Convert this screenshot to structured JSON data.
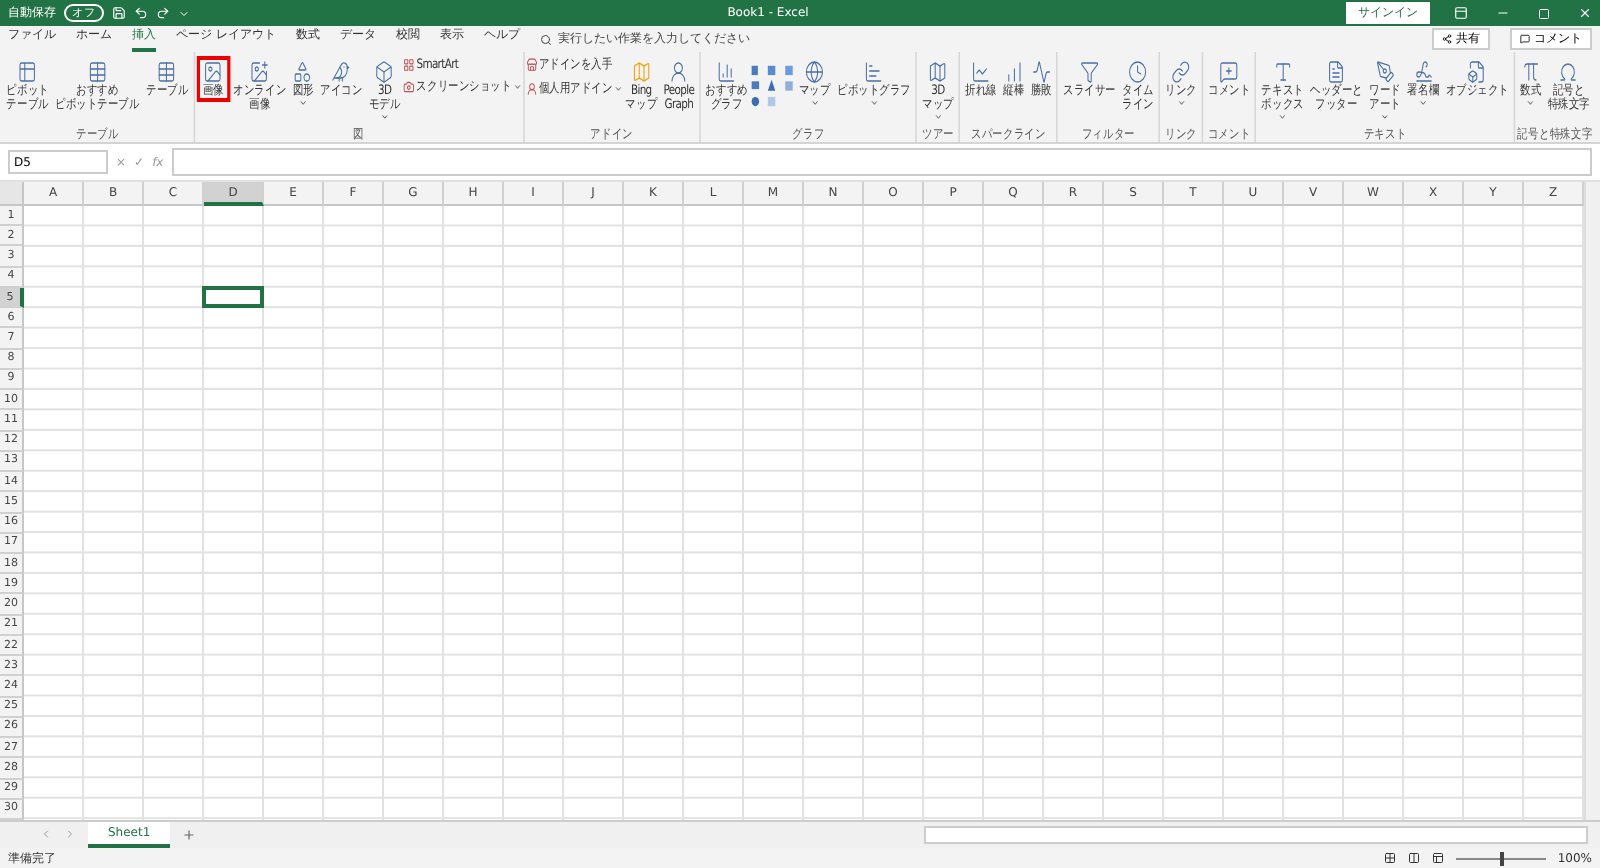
{
  "title_bar": {
    "autosave_label": "自動保存",
    "autosave_toggle": "オフ",
    "autosave_on": false,
    "title": "Book1  -  Excel",
    "sign_in": "サインイン"
  },
  "menu_tabs": [
    {
      "label": "ファイル",
      "selected": false
    },
    {
      "label": "ホーム",
      "selected": false
    },
    {
      "label": "挿入",
      "selected": true
    },
    {
      "label": "ページ レイアウト",
      "selected": false
    },
    {
      "label": "数式",
      "selected": false
    },
    {
      "label": "データ",
      "selected": false
    },
    {
      "label": "校閲",
      "selected": false
    },
    {
      "label": "表示",
      "selected": false
    },
    {
      "label": "ヘルプ",
      "selected": false
    }
  ],
  "search": {
    "placeholder": "実行したい作業を入力してください"
  },
  "share_button": "共有",
  "comment_button": "コメント",
  "ribbon_groups": [
    {
      "name": "テーブル",
      "buttons": [
        {
          "lines": [
            "ピボット",
            "テーブル"
          ],
          "dropdown": false,
          "highlighted": false
        },
        {
          "lines": [
            "おすすめ",
            "ピボットテーブル"
          ],
          "dropdown": false,
          "highlighted": false
        },
        {
          "lines": [
            "テーブル"
          ],
          "dropdown": false,
          "highlighted": false
        }
      ]
    },
    {
      "name": "図",
      "buttons": [
        {
          "lines": [
            "画像"
          ],
          "dropdown": false,
          "highlighted": true
        },
        {
          "lines": [
            "オンライン",
            "画像"
          ],
          "dropdown": false,
          "highlighted": false
        },
        {
          "lines": [
            "図形"
          ],
          "dropdown": true,
          "highlighted": false
        },
        {
          "lines": [
            "アイコン"
          ],
          "dropdown": false,
          "highlighted": false
        },
        {
          "lines": [
            "3D",
            "モデル"
          ],
          "dropdown": true,
          "highlighted": false
        }
      ],
      "small_buttons": [
        {
          "label": "SmartArt",
          "dropdown": false
        },
        {
          "label": "スクリーンショット",
          "dropdown": true
        }
      ]
    },
    {
      "name": "アドイン",
      "small_buttons": [
        {
          "label": "アドインを入手",
          "dropdown": false
        },
        {
          "label": "個人用アドイン",
          "dropdown": true
        }
      ],
      "after": [
        {
          "lines": [
            "Bing",
            "マップ"
          ],
          "dropdown": false,
          "highlighted": false
        },
        {
          "lines": [
            "People",
            "Graph"
          ],
          "dropdown": false,
          "highlighted": false
        }
      ]
    },
    {
      "name": "グラフ",
      "buttons": [
        {
          "lines": [
            "おすすめ",
            "グラフ"
          ],
          "dropdown": false,
          "highlighted": false
        }
      ],
      "after": [
        {
          "lines": [
            "マップ"
          ],
          "dropdown": true,
          "highlighted": false
        },
        {
          "lines": [
            "ピボットグラフ"
          ],
          "dropdown": true,
          "highlighted": false
        }
      ]
    },
    {
      "name": "ツアー",
      "buttons": [
        {
          "lines": [
            "3D",
            "マップ"
          ],
          "dropdown": true,
          "highlighted": false
        }
      ]
    },
    {
      "name": "スパークライン",
      "buttons": [
        {
          "lines": [
            "折れ線"
          ],
          "dropdown": false,
          "highlighted": false
        },
        {
          "lines": [
            "縦棒"
          ],
          "dropdown": false,
          "highlighted": false
        },
        {
          "lines": [
            "勝敗"
          ],
          "dropdown": false,
          "highlighted": false
        }
      ]
    },
    {
      "name": "フィルター",
      "buttons": [
        {
          "lines": [
            "スライサー"
          ],
          "dropdown": false,
          "highlighted": false
        },
        {
          "lines": [
            "タイム",
            "ライン"
          ],
          "dropdown": false,
          "highlighted": false
        }
      ]
    },
    {
      "name": "リンク",
      "buttons": [
        {
          "lines": [
            "リンク"
          ],
          "dropdown": true,
          "highlighted": false
        }
      ]
    },
    {
      "name": "コメント",
      "buttons": [
        {
          "lines": [
            "コメント"
          ],
          "dropdown": false,
          "highlighted": false
        }
      ]
    },
    {
      "name": "テキスト",
      "buttons": [
        {
          "lines": [
            "テキスト",
            "ボックス"
          ],
          "dropdown": true,
          "highlighted": false
        },
        {
          "lines": [
            "ヘッダーと",
            "フッター"
          ],
          "dropdown": false,
          "highlighted": false
        },
        {
          "lines": [
            "ワード",
            "アート"
          ],
          "dropdown": true,
          "highlighted": false
        },
        {
          "lines": [
            "署名欄"
          ],
          "dropdown": true,
          "highlighted": false
        },
        {
          "lines": [
            "オブジェクト"
          ],
          "dropdown": false,
          "highlighted": false
        }
      ]
    },
    {
      "name": "記号と特殊文字",
      "buttons": [
        {
          "lines": [
            "数式"
          ],
          "dropdown": true,
          "highlighted": false
        },
        {
          "lines": [
            "記号と",
            "特殊文字"
          ],
          "dropdown": false,
          "highlighted": false
        }
      ]
    }
  ],
  "formula_bar": {
    "name_box": "D5",
    "cancel": "×",
    "enter": "✓",
    "function": "fx"
  },
  "columns": [
    {
      "label": "A",
      "selected": false
    },
    {
      "label": "B",
      "selected": false
    },
    {
      "label": "C",
      "selected": false
    },
    {
      "label": "D",
      "selected": true
    },
    {
      "label": "E",
      "selected": false
    },
    {
      "label": "F",
      "selected": false
    },
    {
      "label": "G",
      "selected": false
    },
    {
      "label": "H",
      "selected": false
    },
    {
      "label": "I",
      "selected": false
    },
    {
      "label": "J",
      "selected": false
    },
    {
      "label": "K",
      "selected": false
    },
    {
      "label": "L",
      "selected": false
    },
    {
      "label": "M",
      "selected": false
    },
    {
      "label": "N",
      "selected": false
    },
    {
      "label": "O",
      "selected": false
    },
    {
      "label": "P",
      "selected": false
    },
    {
      "label": "Q",
      "selected": false
    },
    {
      "label": "R",
      "selected": false
    },
    {
      "label": "S",
      "selected": false
    },
    {
      "label": "T",
      "selected": false
    },
    {
      "label": "U",
      "selected": false
    },
    {
      "label": "V",
      "selected": false
    },
    {
      "label": "W",
      "selected": false
    },
    {
      "label": "X",
      "selected": false
    },
    {
      "label": "Y",
      "selected": false
    },
    {
      "label": "Z",
      "selected": false
    }
  ],
  "rows": [
    {
      "label": "1",
      "selected": false
    },
    {
      "label": "2",
      "selected": false
    },
    {
      "label": "3",
      "selected": false
    },
    {
      "label": "4",
      "selected": false
    },
    {
      "label": "5",
      "selected": true
    },
    {
      "label": "6",
      "selected": false
    },
    {
      "label": "7",
      "selected": false
    },
    {
      "label": "8",
      "selected": false
    },
    {
      "label": "9",
      "selected": false
    },
    {
      "label": "10",
      "selected": false
    },
    {
      "label": "11",
      "selected": false
    },
    {
      "label": "12",
      "selected": false
    },
    {
      "label": "13",
      "selected": false
    },
    {
      "label": "14",
      "selected": false
    },
    {
      "label": "15",
      "selected": false
    },
    {
      "label": "16",
      "selected": false
    },
    {
      "label": "17",
      "selected": false
    },
    {
      "label": "18",
      "selected": false
    },
    {
      "label": "19",
      "selected": false
    },
    {
      "label": "20",
      "selected": false
    },
    {
      "label": "21",
      "selected": false
    },
    {
      "label": "22",
      "selected": false
    },
    {
      "label": "23",
      "selected": false
    },
    {
      "label": "24",
      "selected": false
    },
    {
      "label": "25",
      "selected": false
    },
    {
      "label": "26",
      "selected": false
    },
    {
      "label": "27",
      "selected": false
    },
    {
      "label": "28",
      "selected": false
    },
    {
      "label": "29",
      "selected": false
    },
    {
      "label": "30",
      "selected": false
    }
  ],
  "sheet_tabs": [
    {
      "label": "Sheet1",
      "selected": true
    }
  ],
  "status_bar": {
    "status": "準備完了",
    "zoom": "100%",
    "zoom_slider": {
      "level": 0.5
    }
  }
}
